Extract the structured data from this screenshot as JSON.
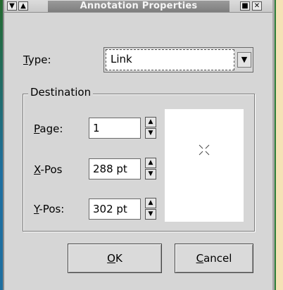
{
  "window": {
    "title": "Annotation Properties",
    "menu_glyph": "▼",
    "shade_glyph": "▲",
    "maximize_glyph": "■",
    "close_glyph": "✕"
  },
  "type_field": {
    "label_mnemonic": "T",
    "label_rest": "ype:",
    "value": "Link",
    "arrow_glyph": "▼"
  },
  "destination": {
    "title": "Destination",
    "page": {
      "label_mnemonic": "P",
      "label_rest": "age:",
      "value": "1"
    },
    "xpos": {
      "label_mnemonic": "X",
      "label_rest": "-Pos",
      "value": "288 pt"
    },
    "ypos": {
      "label_mnemonic": "Y",
      "label_rest": "-Pos:",
      "value": "302 pt"
    },
    "spin_up_glyph": "▲",
    "spin_down_glyph": "▼"
  },
  "buttons": {
    "ok": {
      "mnemonic": "O",
      "rest": "K"
    },
    "cancel": {
      "mnemonic": "C",
      "rest": "ancel"
    }
  },
  "icons": {
    "preview_cursor": "crosshair-icon"
  }
}
